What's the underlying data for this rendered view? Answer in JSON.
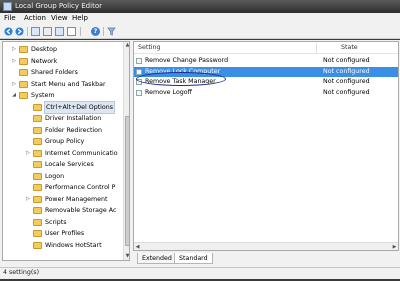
{
  "window": {
    "title": "Local Group Policy Editor"
  },
  "menu": [
    "File",
    "Action",
    "View",
    "Help"
  ],
  "toolbar": {
    "icons": [
      "back-arrow-icon",
      "forward-arrow-icon",
      "up-folder-icon",
      "show-hide-tree-icon",
      "export-list-icon",
      "properties-icon",
      "help-icon",
      "filter-icon"
    ]
  },
  "tree": {
    "items": [
      {
        "label": "Desktop",
        "expandable": true
      },
      {
        "label": "Network",
        "expandable": true
      },
      {
        "label": "Shared Folders",
        "expandable": false
      },
      {
        "label": "Start Menu and Taskbar",
        "expandable": true
      },
      {
        "label": "System",
        "expandable": true,
        "expanded": true
      },
      {
        "label": "Ctrl+Alt+Del Options",
        "expandable": false,
        "selected": true
      },
      {
        "label": "Driver Installation",
        "expandable": false
      },
      {
        "label": "Folder Redirection",
        "expandable": false
      },
      {
        "label": "Group Policy",
        "expandable": false
      },
      {
        "label": "Internet Communicatio",
        "expandable": true
      },
      {
        "label": "Locale Services",
        "expandable": false
      },
      {
        "label": "Logon",
        "expandable": false
      },
      {
        "label": "Performance Control P",
        "expandable": false
      },
      {
        "label": "Power Management",
        "expandable": true
      },
      {
        "label": "Removable Storage Ac",
        "expandable": false
      },
      {
        "label": "Scripts",
        "expandable": false
      },
      {
        "label": "User Profiles",
        "expandable": false
      },
      {
        "label": "Windows HotStart",
        "expandable": false
      }
    ]
  },
  "settings": {
    "headers": {
      "setting": "Setting",
      "state": "State"
    },
    "rows": [
      {
        "name": "Remove Change Password",
        "state": "Not configured"
      },
      {
        "name": "Remove Lock Computer",
        "state": "Not configured",
        "selected": true
      },
      {
        "name": "Remove Task Manager",
        "state": "Not configured"
      },
      {
        "name": "Remove Logoff",
        "state": "Not configured"
      }
    ]
  },
  "tabs": [
    "Extended",
    "Standard"
  ],
  "status": {
    "text": "4 setting(s)"
  },
  "colors": {
    "selection": "#3a8ee6",
    "highlight_circle": "#1c2f8a",
    "folder": "#f2cc60"
  }
}
